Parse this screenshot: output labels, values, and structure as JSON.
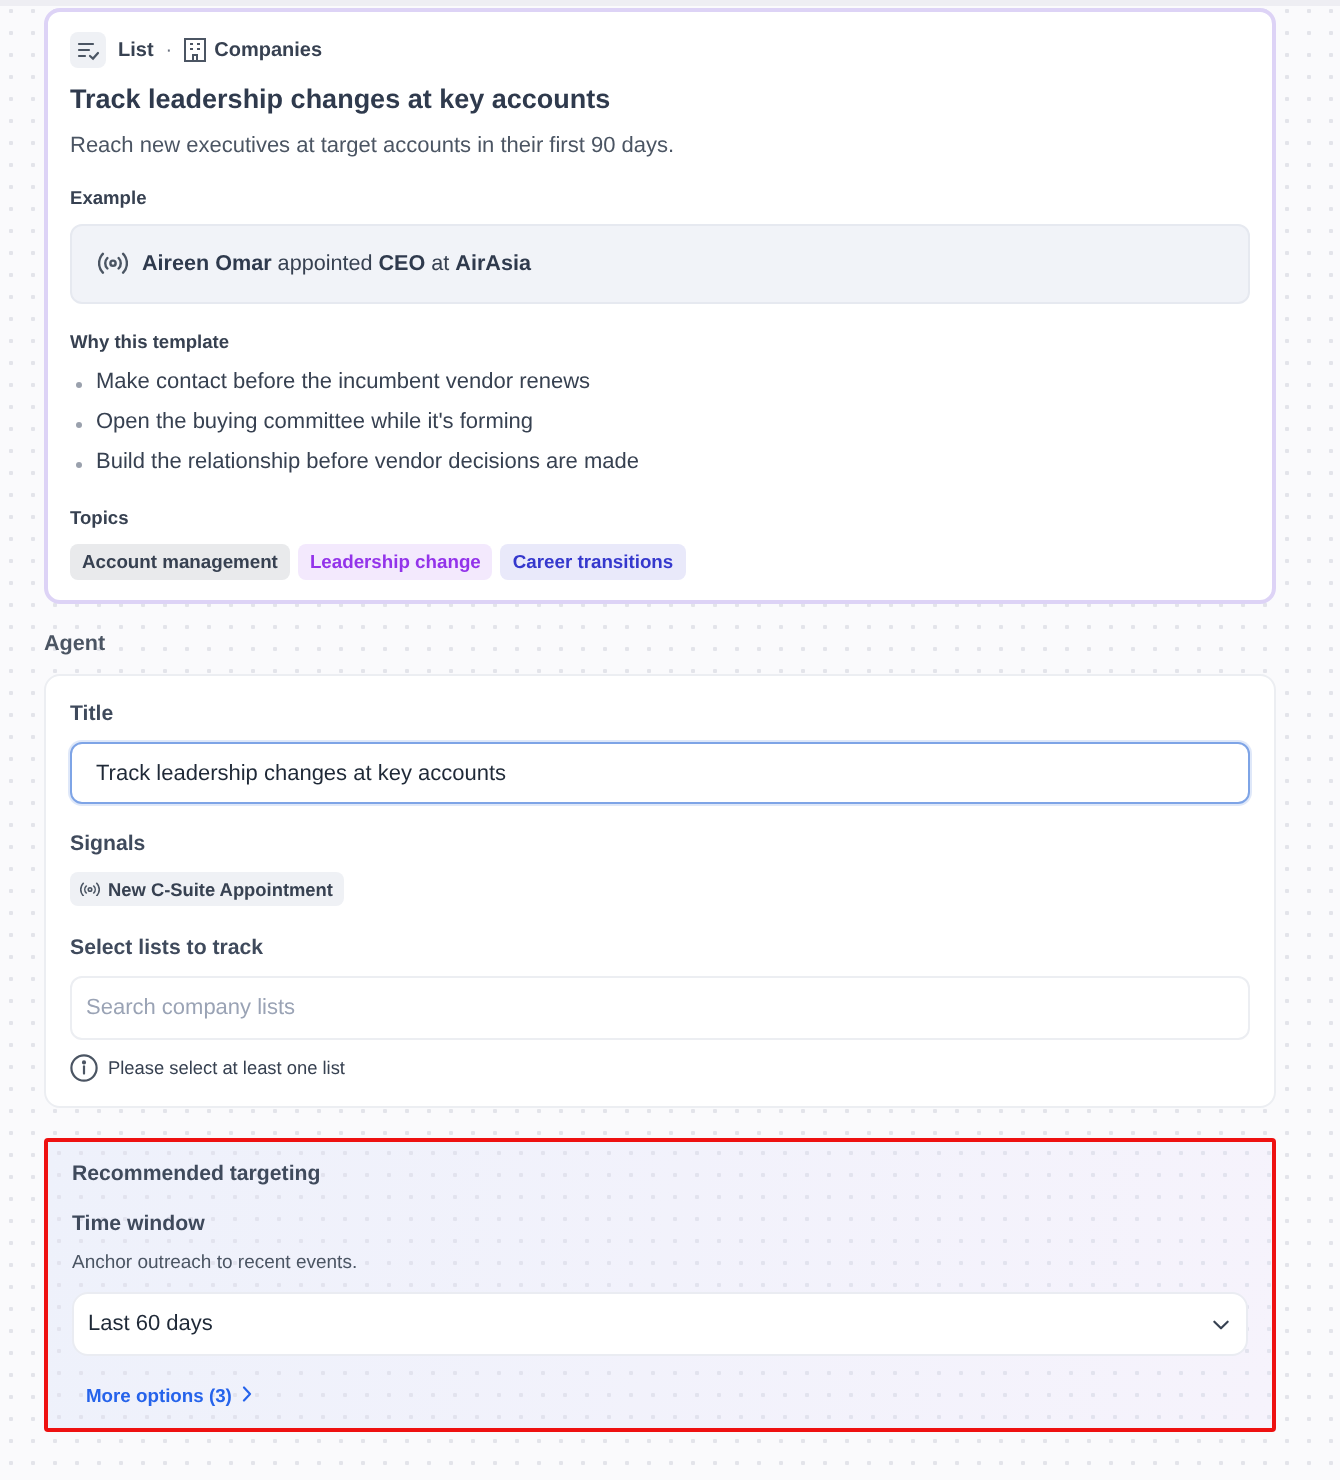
{
  "template": {
    "breadcrumb": {
      "list_label": "List",
      "separator": "·",
      "entity_label": "Companies"
    },
    "title": "Track leadership changes at key accounts",
    "description": "Reach new executives at target accounts in their first 90 days.",
    "example_heading": "Example",
    "example": "**Aireen Omar** appointed **CEO** at **AirAsia**",
    "why_heading": "Why this template",
    "reasons": [
      "Make contact before the incumbent vendor renews",
      "Open the buying committee while it's forming",
      "Build the relationship before vendor decisions are made"
    ],
    "topics_heading": "Topics",
    "topics": [
      {
        "label": "Account management",
        "color": "#374151"
      },
      {
        "label": "Leadership change",
        "color": "#9333ea"
      },
      {
        "label": "Career transitions",
        "color": "#3538cd"
      }
    ]
  },
  "agent": {
    "section_label": "Agent",
    "title_label": "Title",
    "title_value": "Track leadership changes at key accounts",
    "title_focused": true,
    "signals_label": "Signals",
    "signals": [
      "New C-Suite Appointment"
    ],
    "lists_label": "Select lists to track",
    "lists_placeholder": "Search company lists",
    "lists_hint": "Please select at least one list"
  },
  "targeting": {
    "heading": "Recommended targeting",
    "highlighted": true,
    "time_window_label": "Time window",
    "time_window_description": "Anchor outreach to recent events.",
    "time_window_value": "Last 60 days",
    "more_options": "More options (3)"
  }
}
